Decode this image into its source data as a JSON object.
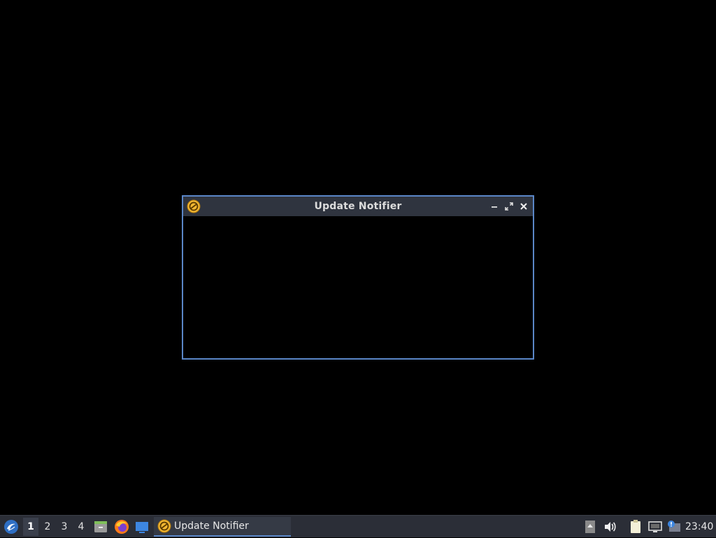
{
  "window": {
    "title": "Update Notifier",
    "icon": "update-notifier-icon",
    "controls": [
      "minimize-icon",
      "maximize-icon",
      "close-icon"
    ]
  },
  "taskbar": {
    "start_icon": "lubuntu-menu-icon",
    "workspaces": [
      "1",
      "2",
      "3",
      "4"
    ],
    "active_workspace": "1",
    "launchers": [
      "file-manager-icon",
      "firefox-icon",
      "show-desktop-icon"
    ],
    "task": {
      "label": "Update Notifier",
      "icon": "update-notifier-icon"
    },
    "tray_icons": [
      "tray-expand-icon",
      "volume-icon",
      "clipboard-icon",
      "network-icon",
      "update-alert-icon"
    ],
    "clock": "23:40"
  },
  "colors": {
    "desktop": "#000000",
    "panel": "#2b2e37",
    "titlebar": "#2f343f",
    "accent": "#5a86c7",
    "notifier": "#f2b632"
  }
}
